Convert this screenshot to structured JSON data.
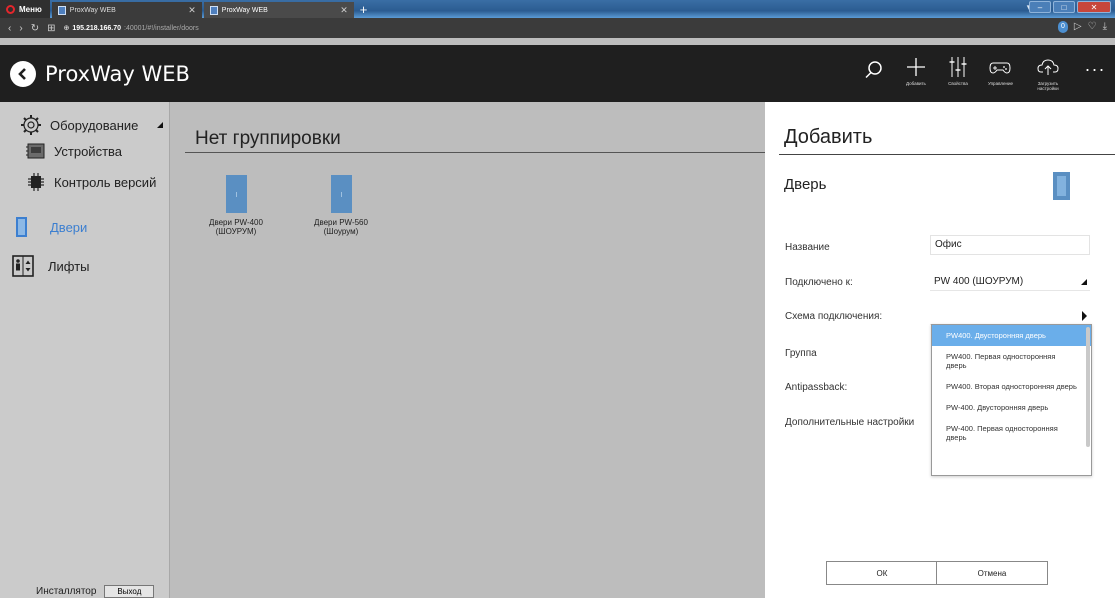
{
  "browser": {
    "menu_label": "Меню",
    "tabs": [
      {
        "title": "ProxWay WEB",
        "active": false
      },
      {
        "title": "ProxWay WEB",
        "active": true
      }
    ],
    "address": {
      "host": "195.218.166.70",
      "port_path": ":40001/#!/installer/doors"
    },
    "speed_badge": "0"
  },
  "app": {
    "title": "ProxWay WEB",
    "toolbar": {
      "add": "Добавить",
      "properties": "Свойства",
      "control": "Управление",
      "upload": "Загрузить настройки"
    }
  },
  "sidebar": {
    "items": [
      {
        "label": "Оборудование",
        "icon": "gear-icon"
      },
      {
        "label": "Устройства",
        "icon": "controller-board-icon"
      },
      {
        "label": "Контроль версий",
        "icon": "chip-icon"
      },
      {
        "label": "Двери",
        "icon": "door-icon",
        "active": true
      },
      {
        "label": "Лифты",
        "icon": "elevator-icon"
      }
    ],
    "footer": {
      "user": "Инсталлятор",
      "logout": "Выход"
    }
  },
  "main": {
    "group_title": "Нет группировки",
    "doors": [
      {
        "label": "Двери PW-400 (ШОУРУМ)"
      },
      {
        "label": "Двери PW-560 (Шоурум)"
      }
    ]
  },
  "panel": {
    "title": "Добавить",
    "subtitle": "Дверь",
    "fields": {
      "name_label": "Название",
      "name_value": "Офис",
      "connected_label": "Подключено к:",
      "connected_value": "PW 400 (ШОУРУМ)",
      "scheme_label": "Схема подключения:",
      "group_label": "Группа",
      "antipassback_label": "Antipassback:",
      "extra_label": "Дополнительные настройки"
    },
    "dropdown": [
      {
        "label": "PW400. Двусторонняя дверь",
        "selected": true
      },
      {
        "label": "PW400. Первая односторонняя дверь"
      },
      {
        "label": "PW400. Вторая односторонняя дверь"
      },
      {
        "label": "PW-400. Двусторонняя дверь"
      },
      {
        "label": "PW-400. Первая односторонняя дверь"
      }
    ],
    "ok_label": "ОК",
    "cancel_label": "Отмена"
  },
  "colors": {
    "accent": "#3c7fd0",
    "door_icon": "#5a8fc2",
    "dropdown_selected": "#6aaeea",
    "header_bg": "#1f1f1f"
  }
}
